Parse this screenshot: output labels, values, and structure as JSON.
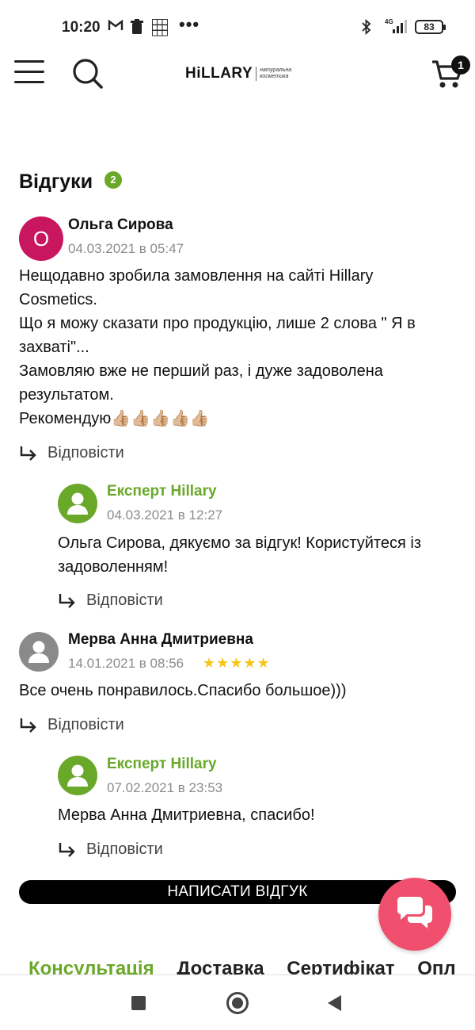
{
  "status_bar": {
    "time": "10:20",
    "network": "4G",
    "battery": "83"
  },
  "header": {
    "logo_brand": "HiLLARY",
    "logo_tagline_1": "натуральна",
    "logo_tagline_2": "косметика",
    "cart_count": "1"
  },
  "reviews": {
    "title": "Відгуки",
    "count": "2",
    "items": [
      {
        "initial": "О",
        "author": "Ольга Сирова",
        "date": "04.03.2021 в 05:47",
        "lines": [
          "Нещодавно зробила замовлення на сайті Hillary",
          "Cosmetics.",
          "Що я можу сказати про продукцію, лише 2 слова \" Я в",
          "захваті\"...",
          "Замовляю вже не перший раз, і дуже задоволена",
          "результатом.",
          "Рекомендую👍🏼👍🏼👍🏼👍🏼👍🏼"
        ],
        "reply_label": "Відповісти",
        "answer": {
          "author": "Експерт Hillary",
          "date": "04.03.2021 в 12:27",
          "lines": [
            "Ольга Сирова, дякуємо за відгук! Користуйтеся із",
            "задоволенням!"
          ],
          "reply_label": "Відповісти"
        }
      },
      {
        "author": "Мерва Анна Дмитриевна",
        "date": "14.01.2021 в 08:56",
        "stars": "★★★★★",
        "rating": 5,
        "lines": [
          "Все очень понравилось.Спасибо большое)))"
        ],
        "reply_label": "Відповісти",
        "answer": {
          "author": "Експерт Hillary",
          "date": "07.02.2021 в 23:53",
          "lines": [
            "Мерва Анна Дмитриевна, спасибо!"
          ],
          "reply_label": "Відповісти"
        }
      }
    ],
    "write_button": "НАПИСАТИ ВІДГУК"
  },
  "tabs": [
    "Консультація",
    "Доставка",
    "Сертифікат",
    "Опл"
  ],
  "colors": {
    "accent_green": "#6aa829",
    "avatar_magenta": "#c8175e",
    "chat_pink": "#f0506e",
    "star_yellow": "#f5c518"
  }
}
